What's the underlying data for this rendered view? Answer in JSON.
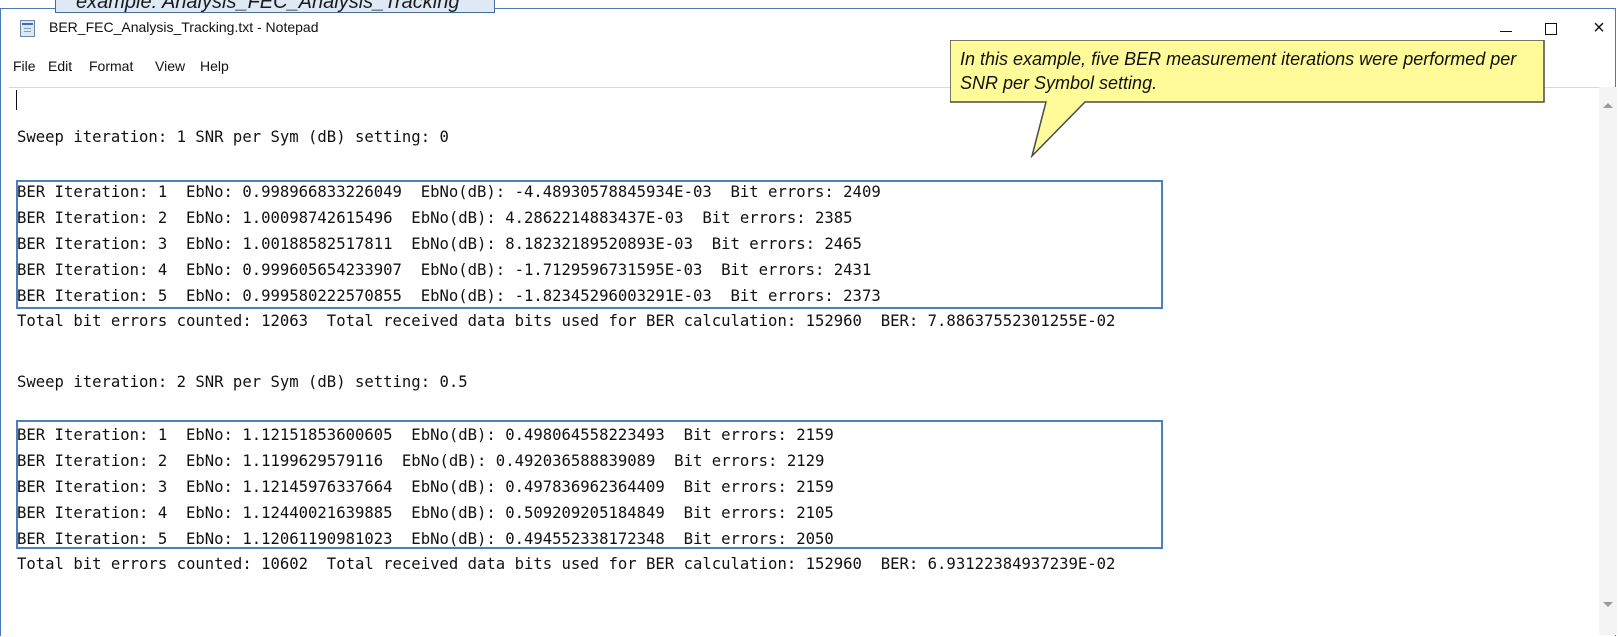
{
  "caption": "example: Analysis_FEC_Analysis_Tracking",
  "window": {
    "title": "BER_FEC_Analysis_Tracking.txt - Notepad",
    "minimize_glyph": "",
    "close_glyph": "×"
  },
  "menu": {
    "file": "File",
    "edit": "Edit",
    "format": "Format",
    "view": "View",
    "help": "Help"
  },
  "callout": {
    "text": "In this example, five BER measurement iterations were performed per SNR per Symbol setting."
  },
  "editor": {
    "lines": [
      "",
      "Sweep iteration: 1 SNR per Sym (dB) setting: 0",
      "",
      "BER Iteration: 1  EbNo: 0.998966833226049  EbNo(dB): -4.48930578845934E-03  Bit errors: 2409",
      "BER Iteration: 2  EbNo: 1.00098742615496  EbNo(dB): 4.2862214883437E-03  Bit errors: 2385",
      "BER Iteration: 3  EbNo: 1.00188582517811  EbNo(dB): 8.18232189520893E-03  Bit errors: 2465",
      "BER Iteration: 4  EbNo: 0.999605654233907  EbNo(dB): -1.7129596731595E-03  Bit errors: 2431",
      "BER Iteration: 5  EbNo: 0.999580222570855  EbNo(dB): -1.82345296003291E-03  Bit errors: 2373",
      "Total bit errors counted: 12063  Total received data bits used for BER calculation: 152960  BER: 7.88637552301255E-02",
      "",
      "Sweep iteration: 2 SNR per Sym (dB) setting: 0.5",
      "",
      "BER Iteration: 1  EbNo: 1.12151853600605  EbNo(dB): 0.498064558223493  Bit errors: 2159",
      "BER Iteration: 2  EbNo: 1.1199629579116  EbNo(dB): 0.492036588839089  Bit errors: 2129",
      "BER Iteration: 3  EbNo: 1.12145976337664  EbNo(dB): 0.497836962364409  Bit errors: 2159",
      "BER Iteration: 4  EbNo: 1.12440021639885  EbNo(dB): 0.509209205184849  Bit errors: 2105",
      "BER Iteration: 5  EbNo: 1.12061190981023  EbNo(dB): 0.494552338172348  Bit errors: 2050",
      "Total bit errors counted: 10602  Total received data bits used for BER calculation: 152960  BER: 6.93122384937239E-02"
    ]
  }
}
